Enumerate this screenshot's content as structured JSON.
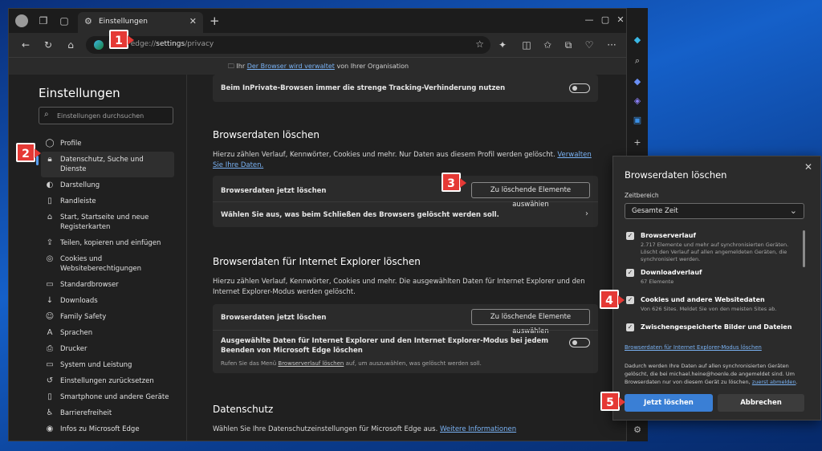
{
  "tab": {
    "title": "Einstellungen"
  },
  "address": {
    "prefix": "E",
    "url_scheme": "edge://",
    "url_path_bold": "settings",
    "url_rest": "/privacy"
  },
  "managed": {
    "pre": "Ihr",
    "link": "Der Browser wird verwaltet",
    "post": "von Ihrer Organisation"
  },
  "sidebar": {
    "title": "Einstellungen",
    "search_placeholder": "Einstellungen durchsuchen",
    "items": [
      {
        "label": "Profile",
        "icon": "person-icon"
      },
      {
        "label": "Datenschutz, Suche und Dienste",
        "icon": "lock-icon",
        "active": true
      },
      {
        "label": "Darstellung",
        "icon": "palette-icon"
      },
      {
        "label": "Randleiste",
        "icon": "sidebar-icon"
      },
      {
        "label": "Start, Startseite und neue Registerkarten",
        "icon": "home-icon"
      },
      {
        "label": "Teilen, kopieren und einfügen",
        "icon": "share-icon"
      },
      {
        "label": "Cookies und Websiteberechtigungen",
        "icon": "cookie-icon"
      },
      {
        "label": "Standardbrowser",
        "icon": "browser-icon"
      },
      {
        "label": "Downloads",
        "icon": "download-icon"
      },
      {
        "label": "Family Safety",
        "icon": "family-icon"
      },
      {
        "label": "Sprachen",
        "icon": "language-icon"
      },
      {
        "label": "Drucker",
        "icon": "printer-icon"
      },
      {
        "label": "System und Leistung",
        "icon": "system-icon"
      },
      {
        "label": "Einstellungen zurücksetzen",
        "icon": "reset-icon"
      },
      {
        "label": "Smartphone und andere Geräte",
        "icon": "phone-icon"
      },
      {
        "label": "Barrierefreiheit",
        "icon": "accessibility-icon"
      },
      {
        "label": "Infos zu Microsoft Edge",
        "icon": "edge-icon"
      }
    ]
  },
  "content": {
    "inprivate_row": "Beim InPrivate-Browsen immer die strenge Tracking-Verhinderung nutzen",
    "clear": {
      "heading": "Browserdaten löschen",
      "desc": "Hierzu zählen Verlauf, Kennwörter, Cookies und mehr. Nur Daten aus diesem Profil werden gelöscht.",
      "desc_link": "Verwalten Sie Ihre Daten.",
      "row1_label": "Browserdaten jetzt löschen",
      "row1_button": "Zu löschende Elemente auswählen",
      "row2_label": "Wählen Sie aus, was beim Schließen des Browsers gelöscht werden soll."
    },
    "ie": {
      "heading": "Browserdaten für Internet Explorer löschen",
      "desc": "Hierzu zählen Verlauf, Kennwörter, Cookies und mehr. Die ausgewählten Daten für Internet Explorer und den Internet Explorer-Modus werden gelöscht.",
      "row1_label": "Browserdaten jetzt löschen",
      "row1_button": "Zu löschende Elemente auswählen",
      "row2_label": "Ausgewählte Daten für Internet Explorer und den Internet Explorer-Modus bei jedem Beenden von Microsoft Edge löschen",
      "row2_small_pre": "Rufen Sie das Menü",
      "row2_small_link": "Browserverlauf löschen",
      "row2_small_post": "auf, um auszuwählen, was gelöscht werden soll."
    },
    "privacy": {
      "heading": "Datenschutz",
      "desc": "Wählen Sie Ihre Datenschutzeinstellungen für Microsoft Edge aus.",
      "desc_link": "Weitere Informationen"
    }
  },
  "dialog": {
    "title": "Browserdaten löschen",
    "range_label": "Zeitbereich",
    "range_value": "Gesamte Zeit",
    "items": [
      {
        "title": "Browserverlauf",
        "desc": "2.717 Elemente und mehr auf synchronisierten Geräten. Löscht den Verlauf auf allen angemeldeten Geräten, die synchronisiert werden."
      },
      {
        "title": "Downloadverlauf",
        "desc": "67 Elemente"
      },
      {
        "title": "Cookies und andere Websitedaten",
        "desc": "Von 626 Sites. Meldet Sie von den meisten Sites ab."
      },
      {
        "title": "Zwischengespeicherte Bilder und Dateien",
        "desc": ""
      }
    ],
    "ie_link": "Browserdaten für Internet Explorer-Modus löschen",
    "note": "Dadurch werden Ihre Daten auf allen synchronisierten Geräten gelöscht, die bei michael.heine@hoenle.de angemeldet sind. Um Browserdaten nur von diesem Gerät zu löschen,",
    "note_link": "zuerst abmelden",
    "note_end": ".",
    "primary": "Jetzt löschen",
    "secondary": "Abbrechen"
  },
  "badges": [
    "1",
    "2",
    "3",
    "4",
    "5"
  ],
  "colors": {
    "accent": "#3a7fd5",
    "badge": "#e53935",
    "link": "#7ab3f5"
  }
}
